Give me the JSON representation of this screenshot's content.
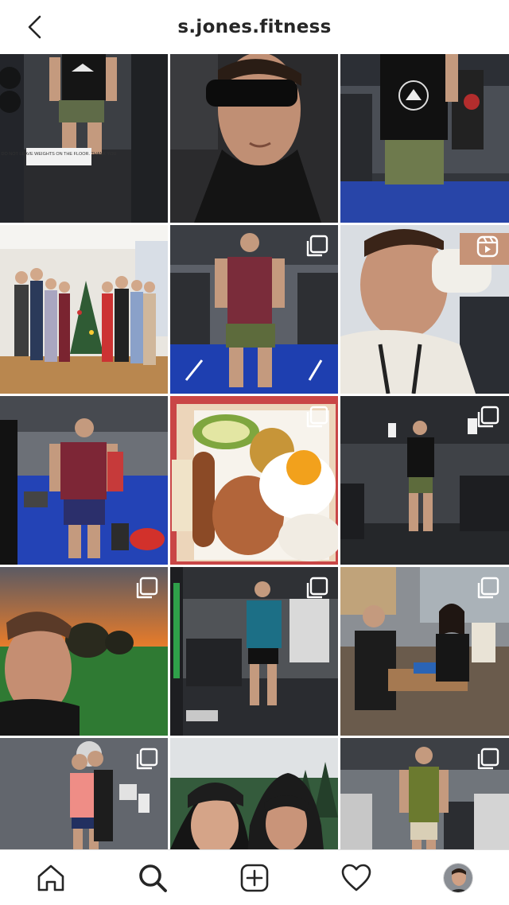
{
  "header": {
    "username": "s.jones.fitness",
    "back_icon": "chevron-left-icon"
  },
  "grid": {
    "posts": [
      {
        "id": 1,
        "alt": "gym-mirror-selfie-tank",
        "badge": "none",
        "sign_text": "DO NOT LEAVE WEIGHTS ON THE FLOOR. THANK YOU"
      },
      {
        "id": 2,
        "alt": "car-selfie-sunglasses",
        "badge": "none"
      },
      {
        "id": 3,
        "alt": "gym-tank-above-all",
        "badge": "none"
      },
      {
        "id": 4,
        "alt": "family-christmas-tree",
        "badge": "none"
      },
      {
        "id": 5,
        "alt": "gym-maroon-tank-turf",
        "badge": "carousel"
      },
      {
        "id": 6,
        "alt": "drinking-shake-selfie",
        "badge": "reel"
      },
      {
        "id": 7,
        "alt": "gym-mirror-maroon-shirt",
        "badge": "none"
      },
      {
        "id": 8,
        "alt": "plate-sausage-egg-rice",
        "badge": "carousel"
      },
      {
        "id": 9,
        "alt": "dark-gym-black-tee",
        "badge": "carousel"
      },
      {
        "id": 10,
        "alt": "sunset-park-selfie",
        "badge": "carousel"
      },
      {
        "id": 11,
        "alt": "gym-teal-tee-mirror",
        "badge": "carousel"
      },
      {
        "id": 12,
        "alt": "cafe-meeting",
        "badge": "carousel"
      },
      {
        "id": 13,
        "alt": "couple-pose-gym",
        "badge": "carousel"
      },
      {
        "id": 14,
        "alt": "hooded-selfie-forest",
        "badge": "none"
      },
      {
        "id": 15,
        "alt": "gym-green-tank",
        "badge": "carousel"
      }
    ]
  },
  "tabbar": {
    "items": [
      {
        "name": "home",
        "icon": "home-icon"
      },
      {
        "name": "search",
        "icon": "search-icon",
        "active": true
      },
      {
        "name": "create",
        "icon": "plus-square-icon"
      },
      {
        "name": "activity",
        "icon": "heart-icon"
      },
      {
        "name": "profile",
        "icon": "profile-avatar"
      }
    ]
  },
  "colors": {
    "text": "#262626",
    "background": "#ffffff",
    "divider": "#dbdbdb"
  }
}
